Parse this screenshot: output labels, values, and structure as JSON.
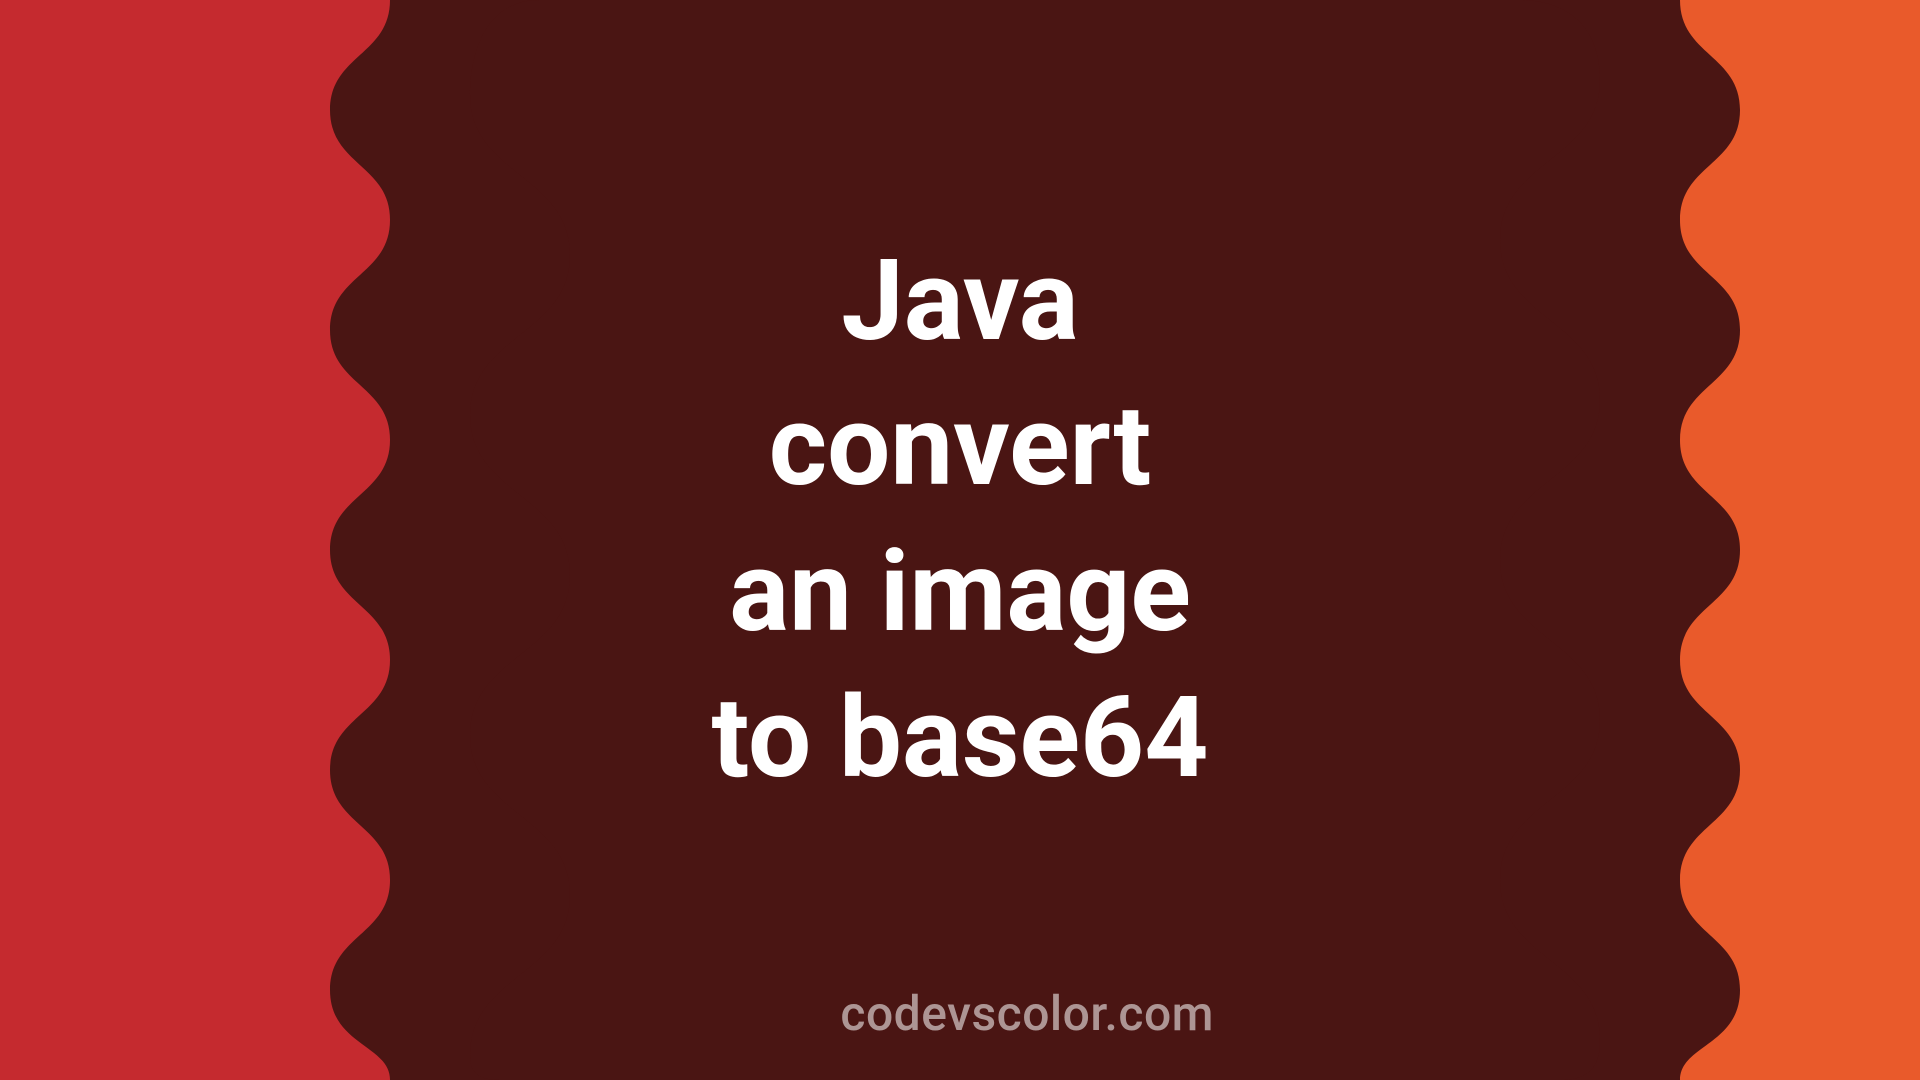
{
  "colors": {
    "left": "#c52a2f",
    "center": "#4a1513",
    "right": "#e95a2b",
    "text": "#ffffff",
    "watermark": "rgba(255,255,255,0.55)"
  },
  "title": {
    "line1": "Java",
    "line2": "convert",
    "line3": "an image",
    "line4": "to base64"
  },
  "watermark": "codevscolor.com"
}
